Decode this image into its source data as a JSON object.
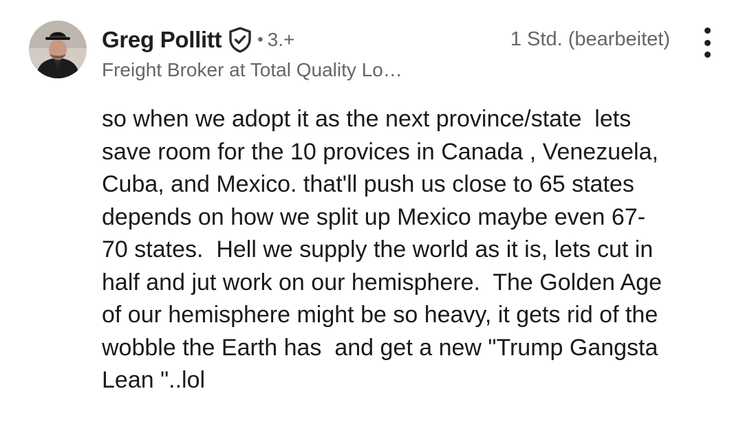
{
  "author": {
    "name": "Greg Pollitt",
    "verified_icon": "verified-shield-icon",
    "connection_degree": "3.+",
    "headline": "Freight Broker at Total Quality Lo…",
    "avatar": "avatar-photo"
  },
  "meta": {
    "timestamp": "1 Std. (bearbeitet)",
    "more_icon": "more-vertical-icon"
  },
  "comment": {
    "lines": [
      "so when we adopt it as the next province/state  lets",
      "save room for the 10 provices in Canada , Venezuela,",
      "Cuba, and Mexico. that'll push us close to 65 states",
      "depends on how we split up Mexico maybe even 67-",
      "70 states.  Hell we supply the world as it is, lets cut in",
      "half and jut work on our hemisphere.  The Golden Age",
      "of our hemisphere might be so heavy, it gets rid of the",
      "wobble the Earth has  and get a new \"Trump Gangsta",
      "Lean \"..lol"
    ]
  },
  "colors": {
    "primary_text": "#1a1a1a",
    "secondary_text": "#666666",
    "background": "#ffffff"
  }
}
